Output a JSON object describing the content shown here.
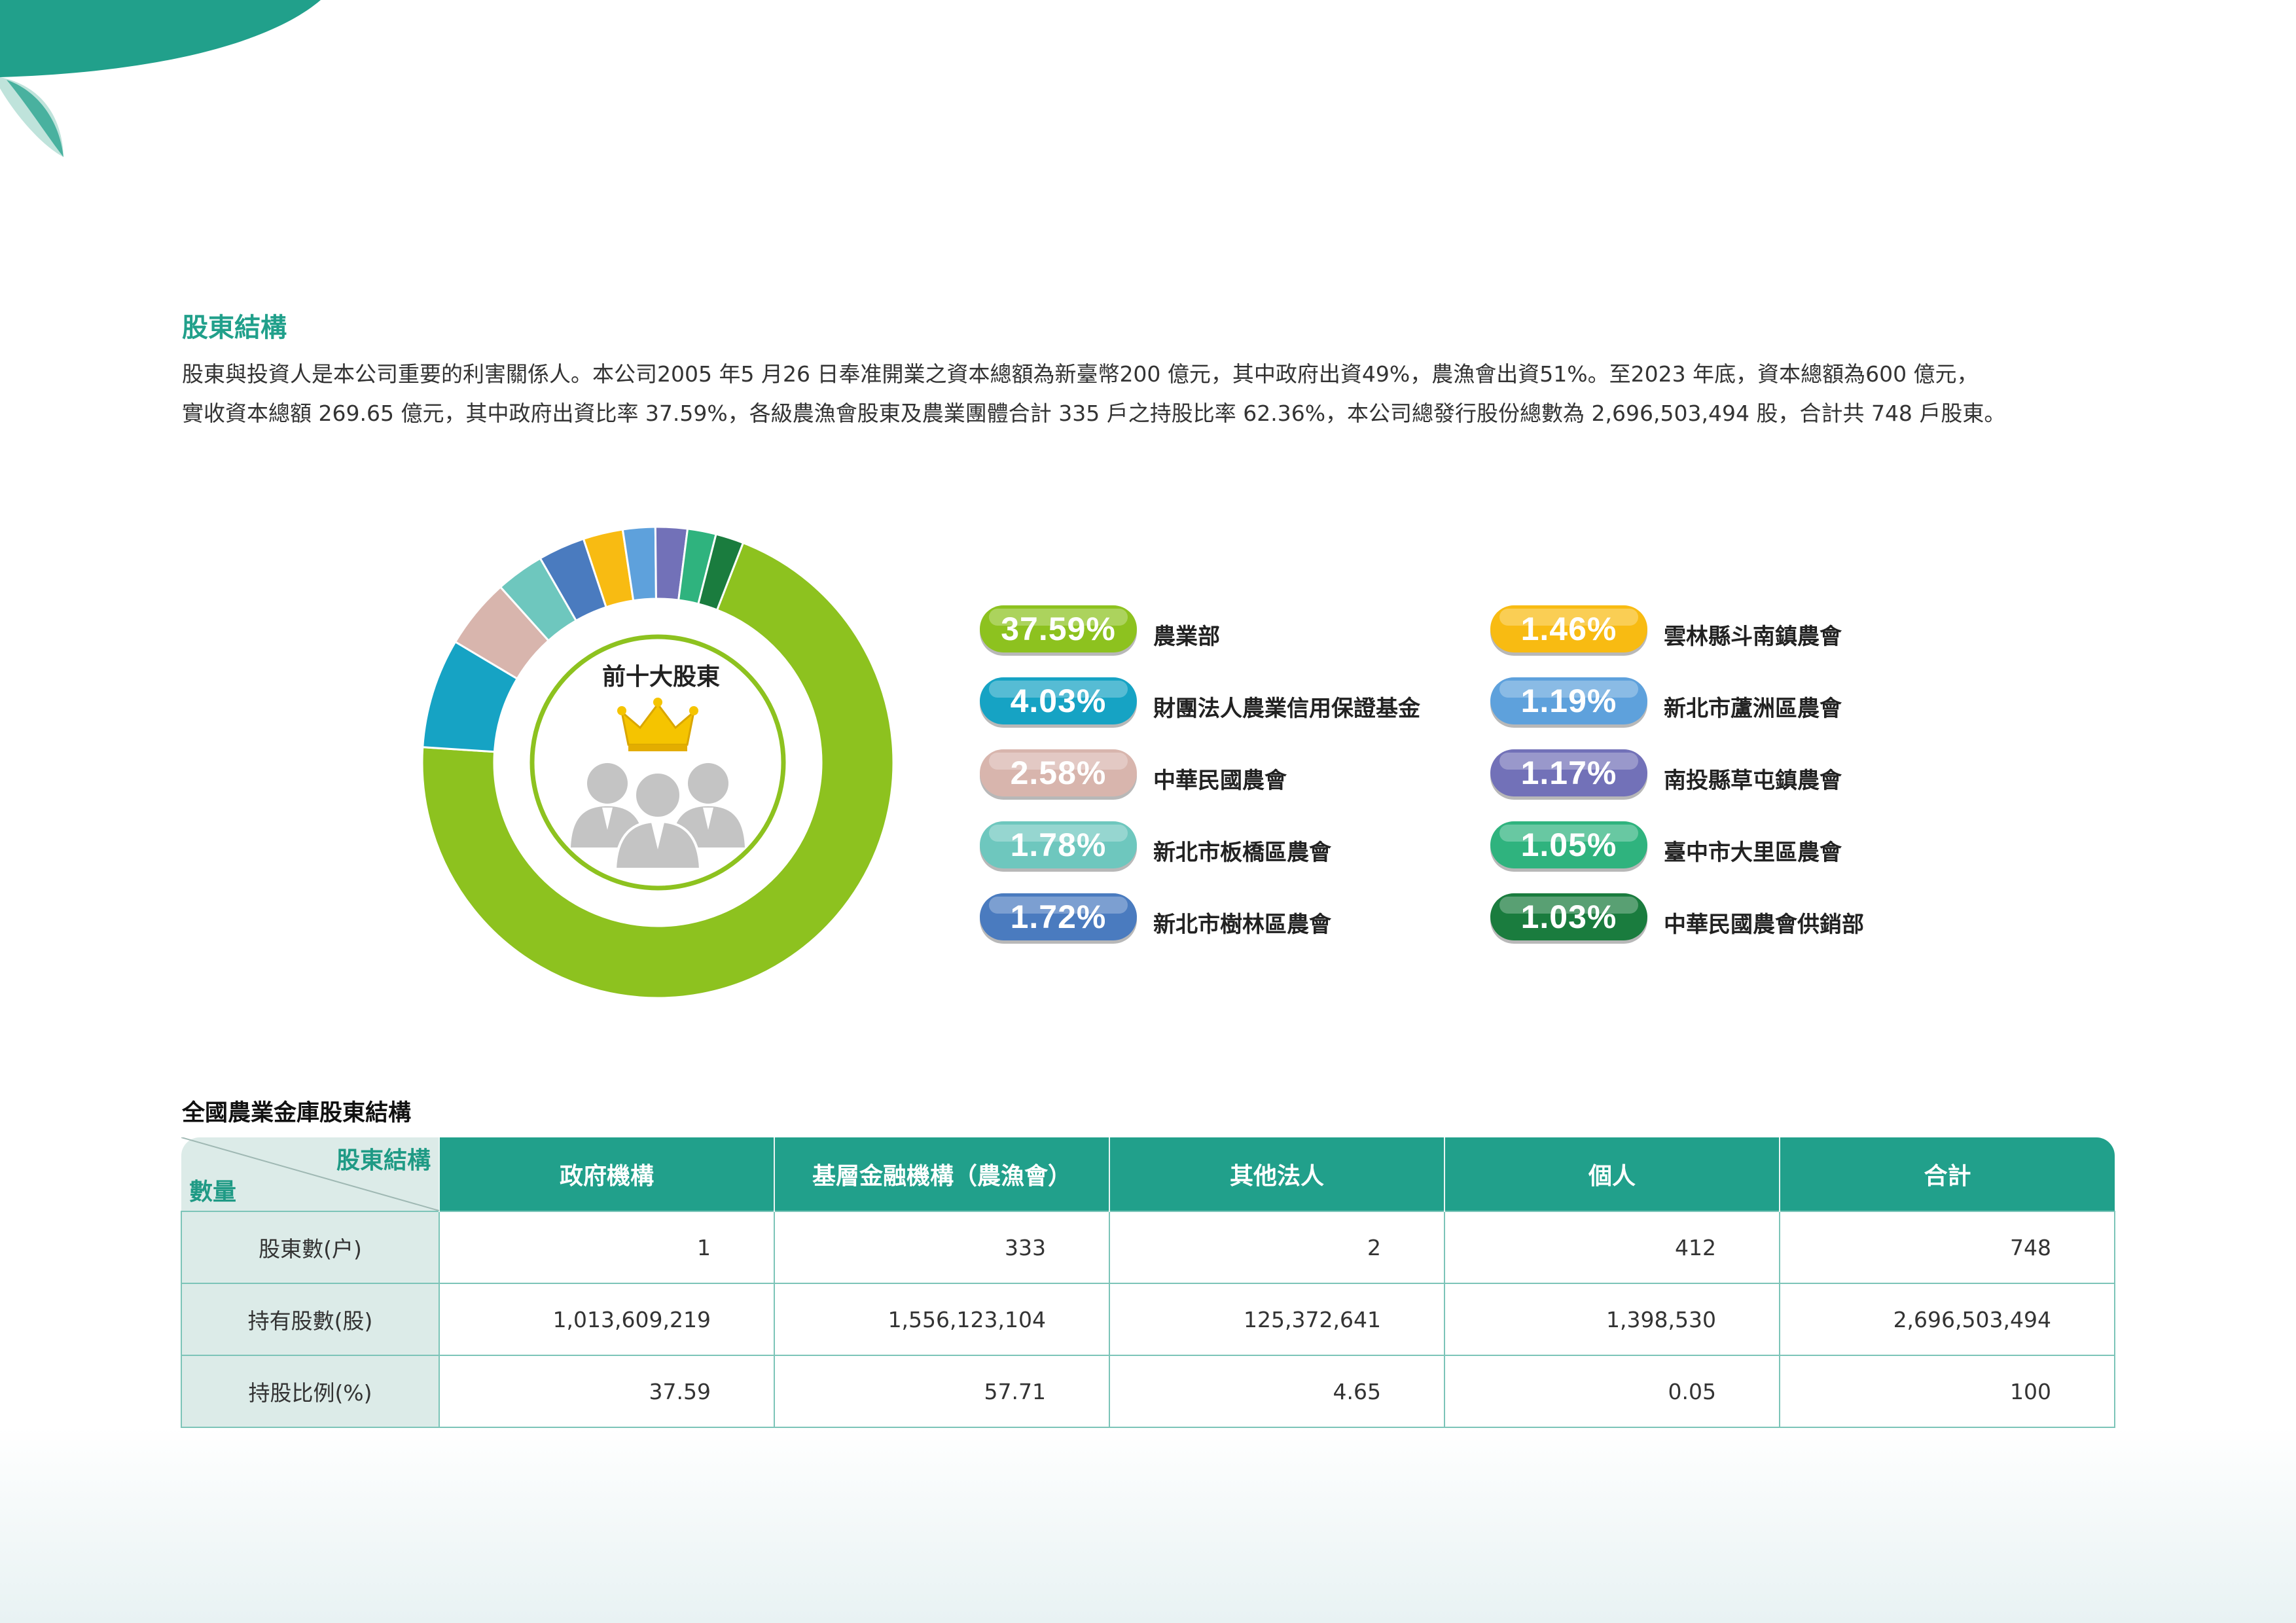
{
  "section": {
    "title": "股東結構",
    "intro_line1": "股東與投資人是本公司重要的利害關係人。本公司2005 年5 月26 日奉准開業之資本總額為新臺幣200 億元，其中政府出資49%，農漁會出資51%。至2023 年底，資本總額為600 億元，",
    "intro_line2": "實收資本總額 269.65 億元，其中政府出資比率 37.59%，各級農漁會股東及農業團體合計 335 戶之持股比率 62.36%，本公司總發行股份總數為 2,696,503,494 股，合計共 748 戶股東。"
  },
  "donut": {
    "center_title": "前十大股東",
    "icon": "shareholders-crown-icon"
  },
  "chart_data": {
    "type": "pie",
    "title": "前十大股東",
    "slices": [
      {
        "label": "農業部",
        "value": 37.59,
        "display": "37.59%",
        "color": "#8dc21f"
      },
      {
        "label": "財團法人農業信用保證基金",
        "value": 4.03,
        "display": "4.03%",
        "color": "#16a3c4"
      },
      {
        "label": "中華民國農會",
        "value": 2.58,
        "display": "2.58%",
        "color": "#d8b5ad"
      },
      {
        "label": "新北市板橋區農會",
        "value": 1.78,
        "display": "1.78%",
        "color": "#6ec7be"
      },
      {
        "label": "新北市樹林區農會",
        "value": 1.72,
        "display": "1.72%",
        "color": "#4a7bbf"
      },
      {
        "label": "雲林縣斗南鎮農會",
        "value": 1.46,
        "display": "1.46%",
        "color": "#f8bb12"
      },
      {
        "label": "新北市蘆洲區農會",
        "value": 1.19,
        "display": "1.19%",
        "color": "#5ea1dc"
      },
      {
        "label": "南投縣草屯鎮農會",
        "value": 1.17,
        "display": "1.17%",
        "color": "#7271b8"
      },
      {
        "label": "臺中市大里區農會",
        "value": 1.05,
        "display": "1.05%",
        "color": "#2fb37e"
      },
      {
        "label": "中華民國農會供銷部",
        "value": 1.03,
        "display": "1.03%",
        "color": "#1a7c3e"
      }
    ]
  },
  "table": {
    "title": "全國農業金庫股東結構",
    "corner_top": "股東結構",
    "corner_bottom": "數量",
    "columns": [
      "政府機構",
      "基層金融機構（農漁會）",
      "其他法人",
      "個人",
      "合計"
    ],
    "rows": [
      {
        "label": "股東數(户)",
        "values": [
          "1",
          "333",
          "2",
          "412",
          "748"
        ]
      },
      {
        "label": "持有股數(股)",
        "values": [
          "1,013,609,219",
          "1,556,123,104",
          "125,372,641",
          "1,398,530",
          "2,696,503,494"
        ]
      },
      {
        "label": "持股比例(%)",
        "values": [
          "37.59",
          "57.71",
          "4.65",
          "0.05",
          "100"
        ]
      }
    ]
  },
  "colors": {
    "accent": "#21a08b",
    "header_light": "#dcebe8",
    "border": "#7cc4b8"
  }
}
